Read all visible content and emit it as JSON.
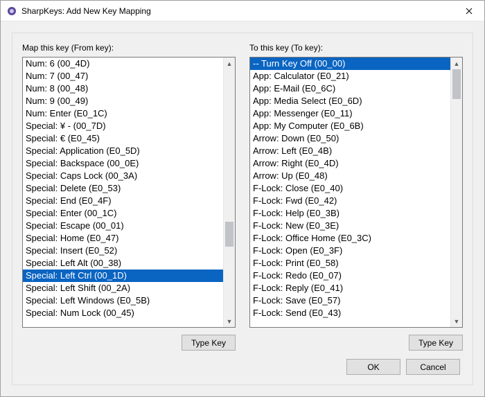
{
  "window": {
    "title": "SharpKeys: Add New Key Mapping"
  },
  "left": {
    "group_label": "Map this key (From key):",
    "type_key_label": "Type Key",
    "selected_index": 17,
    "items": [
      "Num: 6 (00_4D)",
      "Num: 7 (00_47)",
      "Num: 8 (00_48)",
      "Num: 9 (00_49)",
      "Num: Enter (E0_1C)",
      "Special: ¥ - (00_7D)",
      "Special: € (E0_45)",
      "Special: Application (E0_5D)",
      "Special: Backspace (00_0E)",
      "Special: Caps Lock (00_3A)",
      "Special: Delete (E0_53)",
      "Special: End (E0_4F)",
      "Special: Enter (00_1C)",
      "Special: Escape (00_01)",
      "Special: Home (E0_47)",
      "Special: Insert (E0_52)",
      "Special: Left Alt (00_38)",
      "Special: Left Ctrl (00_1D)",
      "Special: Left Shift (00_2A)",
      "Special: Left Windows (E0_5B)",
      "Special: Num Lock (00_45)"
    ],
    "scroll": {
      "thumb_top_pct": 62,
      "thumb_height_pct": 10
    }
  },
  "right": {
    "group_label": "To this key (To key):",
    "type_key_label": "Type Key",
    "selected_index": 0,
    "items": [
      "-- Turn Key Off (00_00)",
      "App: Calculator (E0_21)",
      "App: E-Mail (E0_6C)",
      "App: Media Select (E0_6D)",
      "App: Messenger (E0_11)",
      "App: My Computer (E0_6B)",
      "Arrow: Down (E0_50)",
      "Arrow: Left (E0_4B)",
      "Arrow: Right (E0_4D)",
      "Arrow: Up (E0_48)",
      "F-Lock: Close (E0_40)",
      "F-Lock: Fwd (E0_42)",
      "F-Lock: Help (E0_3B)",
      "F-Lock: New (E0_3E)",
      "F-Lock: Office Home (E0_3C)",
      "F-Lock: Open (E0_3F)",
      "F-Lock: Print (E0_58)",
      "F-Lock: Redo (E0_07)",
      "F-Lock: Reply (E0_41)",
      "F-Lock: Save (E0_57)",
      "F-Lock: Send (E0_43)"
    ],
    "scroll": {
      "thumb_top_pct": 0,
      "thumb_height_pct": 12
    }
  },
  "dialog": {
    "ok_label": "OK",
    "cancel_label": "Cancel"
  }
}
